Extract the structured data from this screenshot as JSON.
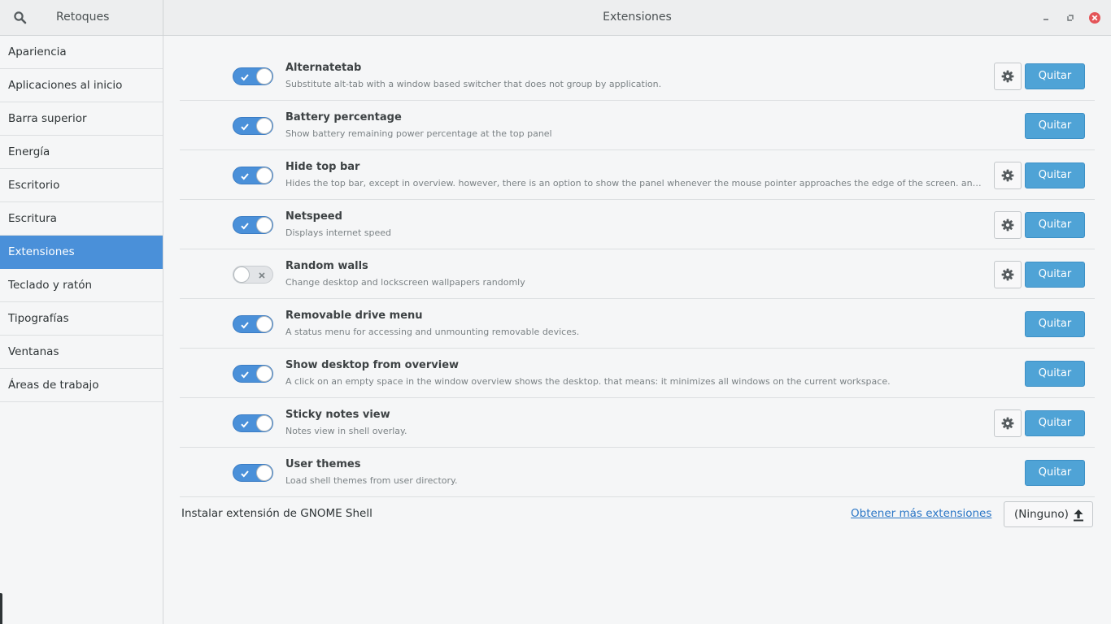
{
  "header": {
    "app_title": "Retoques",
    "page_title": "Extensiones"
  },
  "sidebar": {
    "items": [
      {
        "label": "Apariencia"
      },
      {
        "label": "Aplicaciones al inicio"
      },
      {
        "label": "Barra superior"
      },
      {
        "label": "Energía"
      },
      {
        "label": "Escritorio"
      },
      {
        "label": "Escritura"
      },
      {
        "label": "Extensiones"
      },
      {
        "label": "Teclado y ratón"
      },
      {
        "label": "Tipografías"
      },
      {
        "label": "Ventanas"
      },
      {
        "label": "Áreas de trabajo"
      }
    ]
  },
  "extensions": [
    {
      "name": "Alternatetab",
      "description": "Substitute alt-tab with a window based switcher that does not group by application.",
      "enabled": true,
      "has_settings": true,
      "remove_label": "Quitar"
    },
    {
      "name": "Battery percentage",
      "description": "Show battery remaining power percentage at the top panel",
      "enabled": true,
      "has_settings": false,
      "remove_label": "Quitar"
    },
    {
      "name": "Hide top bar",
      "description": "Hides the top bar, except in overview. however, there is an option to show the panel whenever the mouse pointer approaches the edge of the screen. and if …",
      "enabled": true,
      "has_settings": true,
      "remove_label": "Quitar"
    },
    {
      "name": "Netspeed",
      "description": "Displays internet speed",
      "enabled": true,
      "has_settings": true,
      "remove_label": "Quitar"
    },
    {
      "name": "Random walls",
      "description": "Change desktop and lockscreen wallpapers randomly",
      "enabled": false,
      "has_settings": true,
      "remove_label": "Quitar"
    },
    {
      "name": "Removable drive menu",
      "description": "A status menu for accessing and unmounting removable devices.",
      "enabled": true,
      "has_settings": false,
      "remove_label": "Quitar"
    },
    {
      "name": "Show desktop from overview",
      "description": "A click on an empty space in the window overview shows the desktop. that means: it minimizes all windows on the current workspace.",
      "enabled": true,
      "has_settings": false,
      "remove_label": "Quitar"
    },
    {
      "name": "Sticky notes view",
      "description": "Notes view in shell overlay.",
      "enabled": true,
      "has_settings": true,
      "remove_label": "Quitar"
    },
    {
      "name": "User themes",
      "description": "Load shell themes from user directory.",
      "enabled": true,
      "has_settings": false,
      "remove_label": "Quitar"
    }
  ],
  "footer": {
    "install_label": "Instalar extensión de GNOME Shell",
    "more_link": "Obtener más extensiones",
    "file_button": "(Ninguno)"
  },
  "colors": {
    "accent": "#4a90d9",
    "remove_button": "#4fa3d6",
    "close_button": "#e45458",
    "link": "#2a76c6"
  }
}
